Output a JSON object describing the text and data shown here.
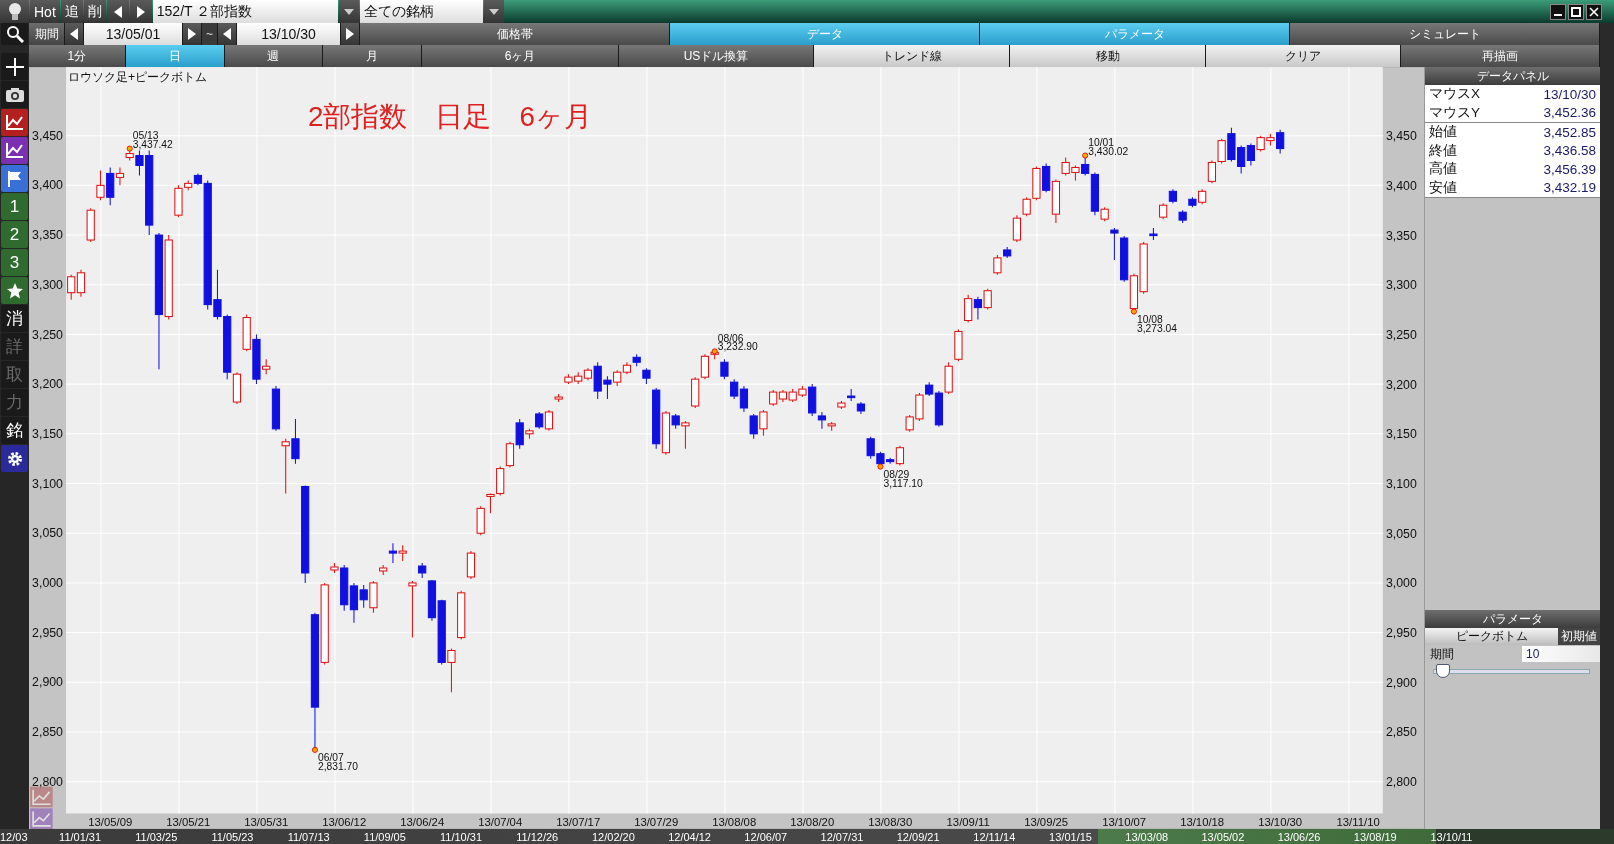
{
  "titlebar": {
    "buttons": [
      "Hot",
      "追",
      "削"
    ],
    "symbol": "152/T ２部指数",
    "universe": "全ての銘柄"
  },
  "period": {
    "label": "期間",
    "from": "13/05/01",
    "separator": "~",
    "to": "13/10/30"
  },
  "mode_tabs": [
    {
      "label": "価格帯",
      "selected": false
    },
    {
      "label": "データ",
      "selected": true
    },
    {
      "label": "パラメータ",
      "selected": true
    },
    {
      "label": "シミュレート",
      "selected": false
    }
  ],
  "toolbar_row": [
    {
      "label": "1分",
      "kind": "tab",
      "selected": false
    },
    {
      "label": "日",
      "kind": "tab",
      "selected": true
    },
    {
      "label": "週",
      "kind": "tab",
      "selected": false
    },
    {
      "label": "月",
      "kind": "tab",
      "selected": false
    },
    {
      "label": "6ヶ月",
      "kind": "tab",
      "selected": false
    },
    {
      "label": "USドル換算",
      "kind": "tab",
      "selected": false
    },
    {
      "label": "トレンド線",
      "kind": "command",
      "selected": false
    },
    {
      "label": "移動",
      "kind": "command",
      "selected": false
    },
    {
      "label": "クリア",
      "kind": "command",
      "selected": false
    },
    {
      "label": "再描画",
      "kind": "tab",
      "selected": false
    }
  ],
  "side_tools": {
    "numbers": [
      "1",
      "2",
      "3"
    ],
    "letters": [
      {
        "label": "消",
        "disabled": false
      },
      {
        "label": "詳",
        "disabled": true
      },
      {
        "label": "取",
        "disabled": true
      },
      {
        "label": "力",
        "disabled": true
      },
      {
        "label": "銘",
        "disabled": false
      }
    ]
  },
  "chart": {
    "legend": "ロウソク足+ピークボトム",
    "title": "2部指数　日足　6ヶ月",
    "axis_end_label": "13/11/10",
    "chart_data": {
      "type": "candlestick",
      "grid": true,
      "ylim": [
        2768,
        3519
      ],
      "yticks": [
        {
          "value": 3450,
          "label": "3,450"
        },
        {
          "value": 3400,
          "label": "3,400"
        },
        {
          "value": 3350,
          "label": "3,350"
        },
        {
          "value": 3300,
          "label": "3,300"
        },
        {
          "value": 3250,
          "label": "3,250"
        },
        {
          "value": 3200,
          "label": "3,200"
        },
        {
          "value": 3150,
          "label": "3,150"
        },
        {
          "value": 3100,
          "label": "3,100"
        },
        {
          "value": 3050,
          "label": "3,050"
        },
        {
          "value": 3000,
          "label": "3,000"
        },
        {
          "value": 2950,
          "label": "2,950"
        },
        {
          "value": 2900,
          "label": "2,900"
        },
        {
          "value": 2850,
          "label": "2,850"
        },
        {
          "value": 2800,
          "label": "2,800"
        }
      ],
      "categories": [
        null,
        null,
        null,
        null,
        "13/05/09",
        null,
        null,
        null,
        null,
        null,
        null,
        null,
        "13/05/21",
        null,
        null,
        null,
        null,
        null,
        null,
        null,
        "13/05/31",
        null,
        null,
        null,
        null,
        null,
        null,
        null,
        "13/06/12",
        null,
        null,
        null,
        null,
        null,
        null,
        null,
        "13/06/24",
        null,
        null,
        null,
        null,
        null,
        null,
        null,
        "13/07/04",
        null,
        null,
        null,
        null,
        null,
        null,
        null,
        "13/07/17",
        null,
        null,
        null,
        null,
        null,
        null,
        null,
        "13/07/29",
        null,
        null,
        null,
        null,
        null,
        null,
        null,
        "13/08/08",
        null,
        null,
        null,
        null,
        null,
        null,
        null,
        "13/08/20",
        null,
        null,
        null,
        null,
        null,
        null,
        null,
        "13/08/30",
        null,
        null,
        null,
        null,
        null,
        null,
        null,
        "13/09/11",
        null,
        null,
        null,
        null,
        null,
        null,
        null,
        "13/09/25",
        null,
        null,
        null,
        null,
        null,
        null,
        null,
        "13/10/07",
        null,
        null,
        null,
        null,
        null,
        null,
        null,
        "13/10/18",
        null,
        null,
        null,
        null,
        null,
        null,
        null,
        "13/10/30"
      ],
      "ohlc": [
        [
          3292,
          3310,
          3285,
          3308
        ],
        [
          3292,
          3315,
          3288,
          3312
        ],
        [
          3345,
          3377,
          3343,
          3375
        ],
        [
          3388,
          3415,
          3385,
          3400
        ],
        [
          3412,
          3418,
          3380,
          3388
        ],
        [
          3408,
          3418,
          3400,
          3412
        ],
        [
          3428,
          3437,
          3425,
          3432
        ],
        [
          3430,
          3435,
          3410,
          3420
        ],
        [
          3430,
          3435,
          3350,
          3360
        ],
        [
          3350,
          3352,
          3215,
          3270
        ],
        [
          3268,
          3350,
          3265,
          3345
        ],
        [
          3370,
          3400,
          3368,
          3397
        ],
        [
          3398,
          3405,
          3395,
          3402
        ],
        [
          3410,
          3412,
          3400,
          3402
        ],
        [
          3402,
          3405,
          3275,
          3280
        ],
        [
          3285,
          3315,
          3265,
          3268
        ],
        [
          3268,
          3270,
          3205,
          3212
        ],
        [
          3182,
          3212,
          3180,
          3210
        ],
        [
          3235,
          3270,
          3233,
          3267
        ],
        [
          3245,
          3250,
          3200,
          3205
        ],
        [
          3215,
          3225,
          3210,
          3218
        ],
        [
          3195,
          3198,
          3153,
          3155
        ],
        [
          3138,
          3145,
          3090,
          3142
        ],
        [
          3145,
          3165,
          3120,
          3125
        ],
        [
          3097,
          3098,
          3000,
          3010
        ],
        [
          2968,
          2970,
          2832,
          2875
        ],
        [
          2920,
          3000,
          2918,
          2998
        ],
        [
          3013,
          3020,
          3010,
          3016
        ],
        [
          3015,
          3018,
          2972,
          2978
        ],
        [
          2997,
          3000,
          2960,
          2973
        ],
        [
          2993,
          2998,
          2975,
          2983
        ],
        [
          2975,
          3002,
          2970,
          3000
        ],
        [
          3012,
          3018,
          3008,
          3015
        ],
        [
          3032,
          3040,
          3020,
          3030
        ],
        [
          3030,
          3038,
          3022,
          3032
        ],
        [
          2997,
          3002,
          2945,
          3000
        ],
        [
          3017,
          3020,
          3005,
          3010
        ],
        [
          3002,
          3003,
          2962,
          2965
        ],
        [
          2982,
          2983,
          2918,
          2920
        ],
        [
          2920,
          2934,
          2890,
          2932
        ],
        [
          2945,
          2992,
          2943,
          2990
        ],
        [
          3006,
          3032,
          3004,
          3030
        ],
        [
          3050,
          3077,
          3048,
          3075
        ],
        [
          3087,
          3090,
          3070,
          3089
        ],
        [
          3090,
          3117,
          3088,
          3115
        ],
        [
          3118,
          3142,
          3116,
          3140
        ],
        [
          3161,
          3165,
          3135,
          3139
        ],
        [
          3150,
          3155,
          3145,
          3153
        ],
        [
          3170,
          3172,
          3155,
          3157
        ],
        [
          3155,
          3174,
          3153,
          3172
        ],
        [
          3185,
          3190,
          3182,
          3187
        ],
        [
          3202,
          3210,
          3200,
          3207
        ],
        [
          3203,
          3212,
          3200,
          3208
        ],
        [
          3206,
          3216,
          3204,
          3214
        ],
        [
          3218,
          3222,
          3185,
          3193
        ],
        [
          3204,
          3208,
          3185,
          3200
        ],
        [
          3202,
          3214,
          3198,
          3212
        ],
        [
          3212,
          3222,
          3210,
          3219
        ],
        [
          3227,
          3230,
          3218,
          3222
        ],
        [
          3214,
          3216,
          3200,
          3206
        ],
        [
          3194,
          3196,
          3135,
          3140
        ],
        [
          3131,
          3173,
          3129,
          3171
        ],
        [
          3168,
          3170,
          3155,
          3159
        ],
        [
          3158,
          3163,
          3135,
          3161
        ],
        [
          3178,
          3207,
          3176,
          3205
        ],
        [
          3207,
          3230,
          3205,
          3228
        ],
        [
          3230,
          3233,
          3225,
          3232
        ],
        [
          3222,
          3225,
          3205,
          3208
        ],
        [
          3202,
          3205,
          3185,
          3188
        ],
        [
          3195,
          3198,
          3172,
          3176
        ],
        [
          3168,
          3170,
          3145,
          3150
        ],
        [
          3155,
          3174,
          3148,
          3172
        ],
        [
          3180,
          3194,
          3178,
          3192
        ],
        [
          3185,
          3194,
          3182,
          3192
        ],
        [
          3184,
          3195,
          3182,
          3192
        ],
        [
          3189,
          3198,
          3187,
          3195
        ],
        [
          3197,
          3200,
          3168,
          3171
        ],
        [
          3168,
          3172,
          3155,
          3164
        ],
        [
          3158,
          3162,
          3153,
          3160
        ],
        [
          3177,
          3183,
          3175,
          3181
        ],
        [
          3188,
          3195,
          3183,
          3187
        ],
        [
          3180,
          3182,
          3170,
          3173
        ],
        [
          3145,
          3147,
          3125,
          3128
        ],
        [
          3130,
          3132,
          3117,
          3120
        ],
        [
          3124,
          3126,
          3120,
          3122
        ],
        [
          3120,
          3138,
          3118,
          3136
        ],
        [
          3154,
          3169,
          3152,
          3167
        ],
        [
          3165,
          3191,
          3163,
          3189
        ],
        [
          3199,
          3202,
          3188,
          3190
        ],
        [
          3191,
          3193,
          3157,
          3159
        ],
        [
          3192,
          3222,
          3190,
          3218
        ],
        [
          3225,
          3255,
          3223,
          3253
        ],
        [
          3264,
          3290,
          3262,
          3286
        ],
        [
          3285,
          3288,
          3265,
          3277
        ],
        [
          3277,
          3296,
          3275,
          3294
        ],
        [
          3312,
          3330,
          3310,
          3327
        ],
        [
          3335,
          3338,
          3327,
          3329
        ],
        [
          3345,
          3370,
          3343,
          3367
        ],
        [
          3371,
          3388,
          3369,
          3386
        ],
        [
          3387,
          3419,
          3385,
          3417
        ],
        [
          3419,
          3422,
          3393,
          3395
        ],
        [
          3371,
          3406,
          3362,
          3404
        ],
        [
          3412,
          3428,
          3410,
          3423
        ],
        [
          3413,
          3420,
          3405,
          3418
        ],
        [
          3421,
          3430,
          3410,
          3412
        ],
        [
          3411,
          3413,
          3370,
          3374
        ],
        [
          3366,
          3378,
          3364,
          3376
        ],
        [
          3355,
          3357,
          3325,
          3352
        ],
        [
          3347,
          3349,
          3303,
          3305
        ],
        [
          3276,
          3311,
          3273,
          3309
        ],
        [
          3293,
          3343,
          3291,
          3341
        ],
        [
          3351,
          3357,
          3345,
          3350
        ],
        [
          3368,
          3382,
          3366,
          3380
        ],
        [
          3394,
          3396,
          3382,
          3384
        ],
        [
          3373,
          3375,
          3362,
          3365
        ],
        [
          3386,
          3388,
          3378,
          3380
        ],
        [
          3383,
          3396,
          3381,
          3394
        ],
        [
          3404,
          3425,
          3402,
          3423
        ],
        [
          3424,
          3447,
          3422,
          3445
        ],
        [
          3452,
          3458,
          3424,
          3426
        ],
        [
          3438,
          3440,
          3412,
          3419
        ],
        [
          3440,
          3442,
          3420,
          3425
        ],
        [
          3436,
          3450,
          3434,
          3448
        ],
        [
          3445,
          3452,
          3440,
          3448
        ],
        [
          3453,
          3456,
          3432,
          3437
        ]
      ]
    },
    "right_axis": [
      "3,450",
      "3,400",
      "3,350",
      "3,300",
      "3,250",
      "3,200",
      "3,150",
      "3,100",
      "3,050",
      "3,000",
      "2,950",
      "2,900",
      "2,850",
      "2,800"
    ],
    "markers": [
      {
        "kind": "peak",
        "date": "05/13",
        "value": "3,437.42"
      },
      {
        "kind": "bottom",
        "date": "06/07",
        "value": "2,831.70"
      },
      {
        "kind": "peak",
        "date": "08/06",
        "value": "3,232.90"
      },
      {
        "kind": "bottom",
        "date": "08/29",
        "value": "3,117.10"
      },
      {
        "kind": "peak",
        "date": "10/01",
        "value": "3,430.02"
      },
      {
        "kind": "bottom",
        "date": "10/08",
        "value": "3,273.04"
      }
    ]
  },
  "data_panel": {
    "title": "データパネル",
    "mouse": [
      {
        "label": "マウスX",
        "value": "13/10/30"
      },
      {
        "label": "マウスY",
        "value": "3,452.36"
      }
    ],
    "prices": [
      {
        "label": "始値",
        "value": "3,452.85"
      },
      {
        "label": "終値",
        "value": "3,436.58"
      },
      {
        "label": "高値",
        "value": "3,456.39"
      },
      {
        "label": "安値",
        "value": "3,432.19"
      }
    ]
  },
  "parameters": {
    "title": "パラメータ",
    "tab": "ピークボトム",
    "reset": "初期値",
    "field_label": "期間",
    "field_value": "10",
    "slider": {
      "level": 0.04
    }
  },
  "overview": [
    "12/03",
    "11/01/31",
    "11/03/25",
    "11/05/23",
    "11/07/13",
    "11/09/05",
    "11/10/31",
    "11/12/26",
    "12/02/20",
    "12/04/12",
    "12/06/07",
    "12/07/31",
    "12/09/21",
    "12/11/14",
    "13/01/15",
    "13/03/08",
    "13/05/02",
    "13/06/26",
    "13/08/19",
    "13/10/11"
  ]
}
